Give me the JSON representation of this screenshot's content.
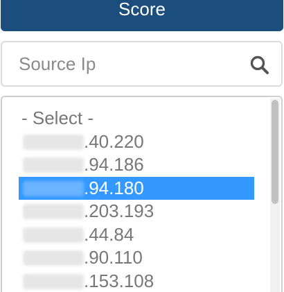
{
  "header": {
    "score_label": "Score"
  },
  "search": {
    "placeholder": "Source Ip",
    "value": "",
    "icon": "search-icon"
  },
  "ip_list": {
    "placeholder_option": "- Select -",
    "items": [
      {
        "visible_suffix": ".40.220",
        "selected": false
      },
      {
        "visible_suffix": ".94.186",
        "selected": false
      },
      {
        "visible_suffix": ".94.180",
        "selected": true
      },
      {
        "visible_suffix": ".203.193",
        "selected": false
      },
      {
        "visible_suffix": ".44.84",
        "selected": false
      },
      {
        "visible_suffix": ".90.110",
        "selected": false
      },
      {
        "visible_suffix": ".153.108",
        "selected": false
      }
    ]
  },
  "colors": {
    "score_button_bg": "#1b4e7c",
    "selected_bg": "#3399ff",
    "text_gray": "#777777"
  }
}
